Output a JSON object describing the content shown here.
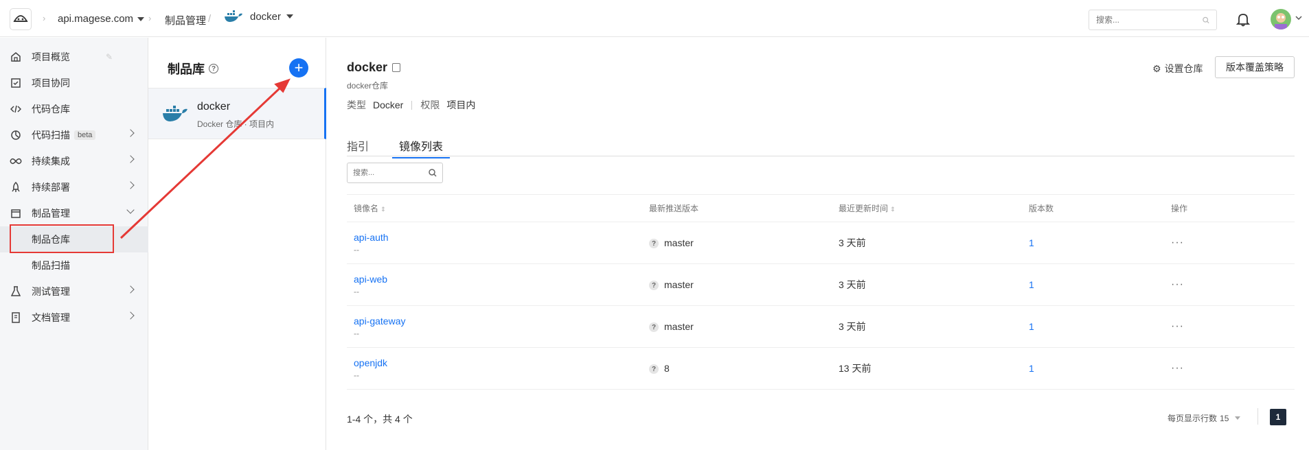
{
  "topbar": {
    "project": "api.magese.com",
    "artifact_crumb": "制品管理",
    "slash": "/",
    "repo": "docker",
    "search_placeholder": "搜索..."
  },
  "leftnav": {
    "items": [
      {
        "label": "项目概览",
        "icon": "home-icon"
      },
      {
        "label": "项目协同",
        "icon": "checkbox-icon"
      },
      {
        "label": "代码仓库",
        "icon": "code-icon"
      },
      {
        "label": "代码扫描",
        "icon": "scan-icon",
        "badge": "beta"
      },
      {
        "label": "持续集成",
        "icon": "infinity-icon"
      },
      {
        "label": "持续部署",
        "icon": "rocket-icon"
      },
      {
        "label": "制品管理",
        "icon": "box-icon"
      },
      {
        "label": "测试管理",
        "icon": "flask-icon"
      },
      {
        "label": "文档管理",
        "icon": "book-icon"
      }
    ],
    "sub_items": [
      "制品仓库",
      "制品扫描"
    ]
  },
  "midpanel": {
    "title": "制品库",
    "repo_name": "docker",
    "repo_sub": "Docker 仓库 · 项目内"
  },
  "main": {
    "title": "docker",
    "subtitle": "docker仓库",
    "type_label": "类型",
    "type_value": "Docker",
    "perm_label": "权限",
    "perm_value": "项目内",
    "settings": "设置仓库",
    "policy_button": "版本覆盖策略",
    "tabs": [
      "指引",
      "镜像列表"
    ],
    "search_placeholder": "搜索...",
    "columns": [
      "镜像名",
      "最新推送版本",
      "最近更新时间",
      "版本数",
      "操作"
    ],
    "rows": [
      {
        "name": "api-auth",
        "desc": "--",
        "version": "master",
        "updated": "3 天前",
        "count": "1",
        "ops": "···"
      },
      {
        "name": "api-web",
        "desc": "--",
        "version": "master",
        "updated": "3 天前",
        "count": "1",
        "ops": "···"
      },
      {
        "name": "api-gateway",
        "desc": "--",
        "version": "master",
        "updated": "3 天前",
        "count": "1",
        "ops": "···"
      },
      {
        "name": "openjdk",
        "desc": "--",
        "version": "8",
        "updated": "13 天前",
        "count": "1",
        "ops": "···"
      }
    ],
    "pager_info": "1-4 个，共 4 个",
    "per_page_label": "每页显示行数",
    "per_page_value": "15",
    "current_page": "1"
  },
  "colors": {
    "accent": "#1672f3",
    "annotation": "#e53935",
    "nav_bg": "#f5f6f8"
  }
}
